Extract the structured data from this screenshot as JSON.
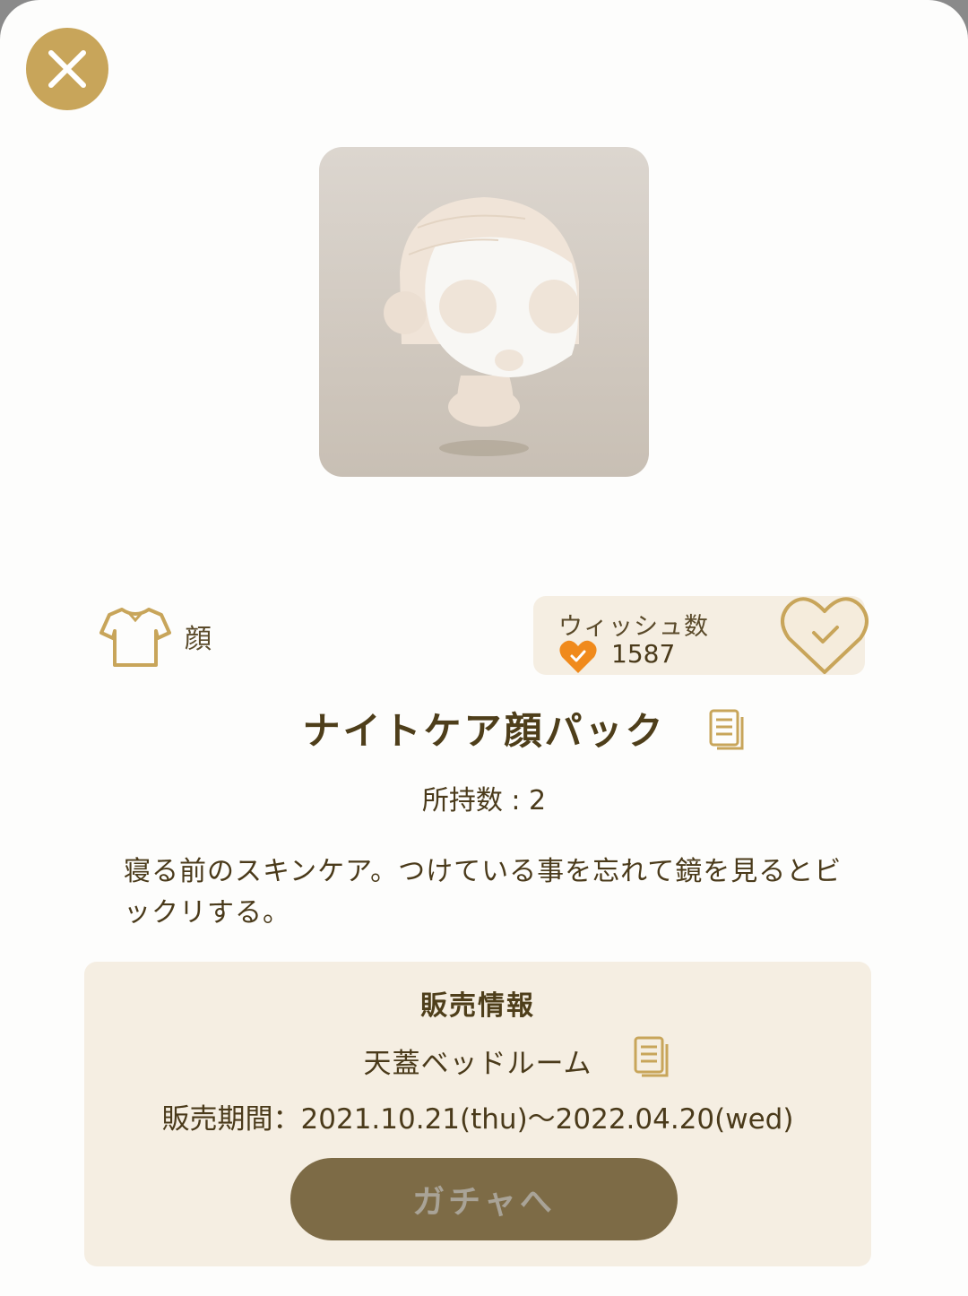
{
  "item": {
    "category_label": "顔",
    "category_icon": "shirt-icon",
    "name": "ナイトケア顔パック",
    "owned": "所持数 : 2",
    "description": "寝る前のスキンケア。つけている事を忘れて鏡を見るとビックリする。"
  },
  "wish": {
    "label": "ウィッシュ数",
    "count": "1587",
    "heart_color": "#f08a1c"
  },
  "sale": {
    "title": "販売情報",
    "gacha_name": "天蓋ベッドルーム",
    "period": "販売期間：2021.10.21(thu)～2022.04.20(wed)",
    "button_label": "ガチャへ"
  },
  "colors": {
    "accent_gold": "#c8a55a",
    "panel_bg": "#f5eee2",
    "button_bg": "#7d6b46",
    "text_brown": "#4a3a1a"
  }
}
